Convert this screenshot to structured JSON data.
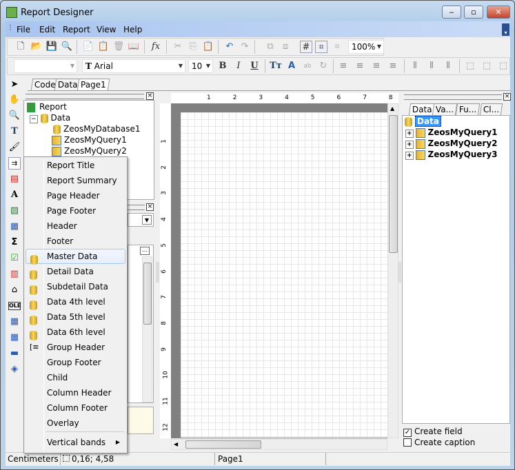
{
  "window": {
    "title": "Report Designer",
    "minimize_icon": "minimize-icon",
    "maximize_icon": "maximize-icon",
    "close_icon": "close-icon"
  },
  "menu": [
    "File",
    "Edit",
    "Report",
    "View",
    "Help"
  ],
  "toolbar": {
    "zoom": "100%",
    "font_name": "Arial",
    "font_size": "10",
    "style": ""
  },
  "tabs": [
    "Code",
    "Data",
    "Page1"
  ],
  "report_tree": {
    "root": "Report",
    "data": "Data",
    "children": [
      "ZeosMyDatabase1",
      "ZeosMyQuery1",
      "ZeosMyQuery2"
    ]
  },
  "popup_menu": [
    {
      "label": "Report Title"
    },
    {
      "label": "Report Summary"
    },
    {
      "label": "Page Header"
    },
    {
      "label": "Page Footer"
    },
    {
      "label": "Header"
    },
    {
      "label": "Footer"
    },
    {
      "label": "Master Data",
      "icon": "database-icon",
      "highlighted": true
    },
    {
      "label": "Detail Data",
      "icon": "database-icon"
    },
    {
      "label": "Subdetail Data",
      "icon": "database-icon"
    },
    {
      "label": "Data 4th level",
      "icon": "database-icon"
    },
    {
      "label": "Data 5th level",
      "icon": "database-icon"
    },
    {
      "label": "Data 6th level",
      "icon": "database-icon"
    },
    {
      "label": "Group Header",
      "icon": "group-icon"
    },
    {
      "label": "Group Footer"
    },
    {
      "label": "Child"
    },
    {
      "label": "Column Header"
    },
    {
      "label": "Column Footer"
    },
    {
      "label": "Overlay"
    },
    {
      "label": "Vertical bands",
      "submenu": true
    }
  ],
  "ruler_h": [
    "1",
    "2",
    "3",
    "4",
    "5",
    "6",
    "7",
    "8"
  ],
  "ruler_v": [
    "1",
    "2",
    "3",
    "4",
    "5",
    "6",
    "7",
    "8",
    "9",
    "10",
    "11",
    "12"
  ],
  "right_panel": {
    "tabs": [
      "Data",
      "Va...",
      "Fu...",
      "Cl..."
    ],
    "root": "Data",
    "items": [
      "ZeosMyQuery1",
      "ZeosMyQuery2",
      "ZeosMyQuery3"
    ],
    "create_field": {
      "label": "Create field",
      "checked": true
    },
    "create_caption": {
      "label": "Create caption",
      "checked": false
    }
  },
  "status": {
    "units": "Centimeters",
    "position": "0,16; 4,58",
    "page": "Page1"
  }
}
